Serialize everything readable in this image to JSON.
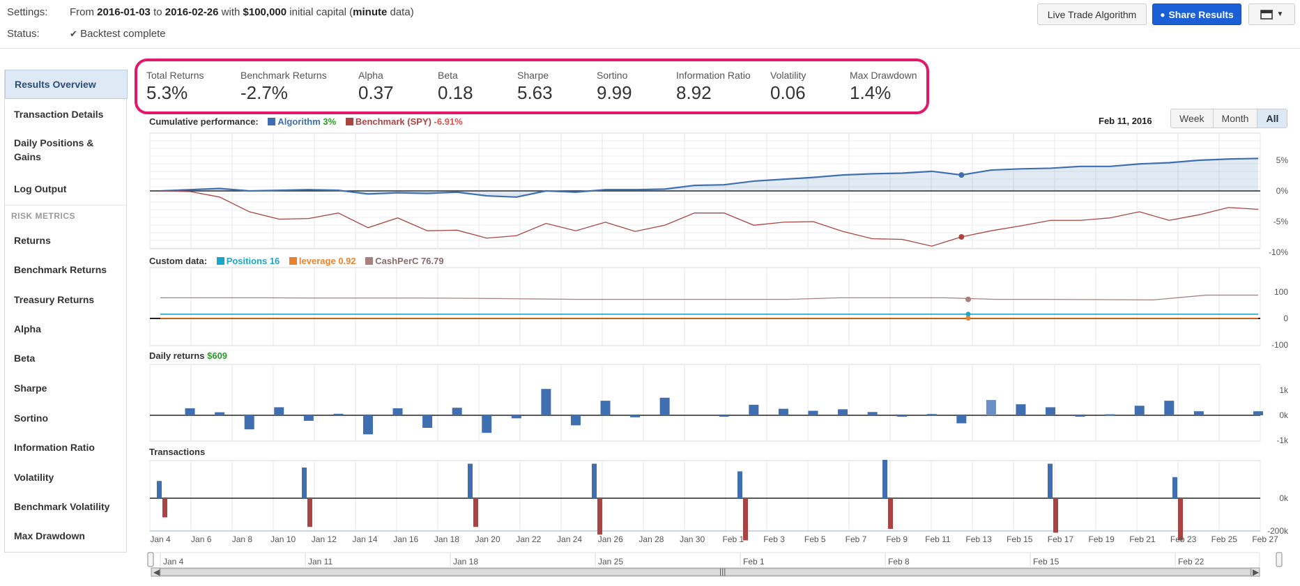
{
  "settings": {
    "label": "Settings:",
    "from_word": "From",
    "start": "2016-01-03",
    "to_word": "to",
    "end": "2016-02-26",
    "with_word": "with",
    "capital": "$100,000",
    "capital_suffix": "initial capital (",
    "frequency": "minute",
    "freq_suffix": "data)"
  },
  "status": {
    "label": "Status:",
    "value": "Backtest complete",
    "icon": "check-icon"
  },
  "toolbar": {
    "live_trade": "Live Trade Algorithm",
    "share": "Share Results",
    "share_icon": "comments-icon",
    "menu_icon": "calendar-icon"
  },
  "sidebar": {
    "items": [
      "Results Overview",
      "Transaction Details",
      "Daily Positions & Gains",
      "Log Output"
    ],
    "risk_header": "RISK METRICS",
    "risk_items": [
      "Returns",
      "Benchmark Returns",
      "Treasury Returns",
      "Alpha",
      "Beta",
      "Sharpe",
      "Sortino",
      "Information Ratio",
      "Volatility",
      "Benchmark Volatility",
      "Max Drawdown"
    ]
  },
  "metrics": [
    {
      "label": "Total Returns",
      "value": "5.3%"
    },
    {
      "label": "Benchmark Returns",
      "value": "-2.7%"
    },
    {
      "label": "Alpha",
      "value": "0.37"
    },
    {
      "label": "Beta",
      "value": "0.18"
    },
    {
      "label": "Sharpe",
      "value": "5.63"
    },
    {
      "label": "Sortino",
      "value": "9.99"
    },
    {
      "label": "Information Ratio",
      "value": "8.92"
    },
    {
      "label": "Volatility",
      "value": "0.06"
    },
    {
      "label": "Max Drawdown",
      "value": "1.4%"
    }
  ],
  "cumulative": {
    "label": "Cumulative performance:",
    "algo_name": "Algorithm",
    "algo_value": "3%",
    "bench_name": "Benchmark (SPY)",
    "bench_value": "-6.91%",
    "hover_date": "Feb 11, 2016",
    "range_buttons": [
      "Week",
      "Month",
      "All"
    ],
    "active_range": "All"
  },
  "custom": {
    "label": "Custom data:",
    "series": [
      {
        "name": "Positions",
        "value": "16",
        "color": "#1aa6c8"
      },
      {
        "name": "leverage",
        "value": "0.92",
        "color": "#e8822e"
      },
      {
        "name": "CashPerC",
        "value": "76.79",
        "color": "#a98080"
      }
    ]
  },
  "daily": {
    "label": "Daily returns",
    "value": "$609"
  },
  "transactions": {
    "label": "Transactions"
  },
  "colors": {
    "algo": "#3f6fb0",
    "bench": "#a94442",
    "accent": "#e3186a",
    "primary": "#1a5fd6"
  },
  "chart_data": [
    {
      "type": "line",
      "title": "Cumulative performance",
      "x": [
        "Jan 4",
        "Jan 5",
        "Jan 6",
        "Jan 7",
        "Jan 8",
        "Jan 11",
        "Jan 12",
        "Jan 13",
        "Jan 14",
        "Jan 15",
        "Jan 19",
        "Jan 20",
        "Jan 21",
        "Jan 22",
        "Jan 25",
        "Jan 26",
        "Jan 27",
        "Jan 28",
        "Jan 29",
        "Feb 1",
        "Feb 2",
        "Feb 3",
        "Feb 4",
        "Feb 5",
        "Feb 8",
        "Feb 9",
        "Feb 10",
        "Feb 11",
        "Feb 12",
        "Feb 16",
        "Feb 17",
        "Feb 18",
        "Feb 19",
        "Feb 22",
        "Feb 23",
        "Feb 24",
        "Feb 25",
        "Feb 26"
      ],
      "series": [
        {
          "name": "Algorithm",
          "values": [
            0,
            0.2,
            0.4,
            0.0,
            0.1,
            0.2,
            0.1,
            -0.5,
            -0.3,
            -0.4,
            -0.2,
            -0.8,
            -1.0,
            0.0,
            -0.2,
            0.2,
            0.2,
            0.3,
            0.9,
            1.0,
            1.6,
            1.9,
            2.2,
            2.6,
            2.8,
            2.9,
            3.2,
            2.6,
            3.4,
            3.6,
            3.7,
            4.0,
            4.0,
            4.4,
            4.6,
            5.0,
            5.2,
            5.3
          ]
        },
        {
          "name": "Benchmark (SPY)",
          "values": [
            0,
            -0.1,
            -1.0,
            -3.4,
            -4.6,
            -4.5,
            -3.6,
            -6.0,
            -4.4,
            -6.5,
            -6.4,
            -7.7,
            -7.3,
            -5.3,
            -6.5,
            -5.1,
            -6.6,
            -5.6,
            -3.6,
            -3.6,
            -5.6,
            -5.1,
            -5.0,
            -6.6,
            -7.8,
            -7.9,
            -9.0,
            -7.5,
            -6.5,
            -5.7,
            -4.8,
            -4.8,
            -4.4,
            -3.4,
            -4.8,
            -3.9,
            -2.7,
            -3.0
          ]
        }
      ],
      "yticks": [
        "5%",
        "0%",
        "-5%",
        "-10%"
      ],
      "ylim": [
        -10,
        5
      ]
    },
    {
      "type": "line",
      "title": "Custom data",
      "series": [
        {
          "name": "Positions",
          "values": [
            16,
            16,
            16,
            16,
            16,
            16,
            16,
            16,
            16,
            16,
            16,
            16,
            16,
            16,
            16,
            16,
            16,
            16,
            16,
            16,
            16,
            16
          ]
        },
        {
          "name": "leverage",
          "values": [
            0.92,
            0.92,
            0.92,
            0.92,
            0.92,
            0.92,
            0.92,
            0.92,
            0.92,
            0.92,
            0.92,
            0.92,
            0.92,
            0.92,
            0.92,
            0.92,
            0.92,
            0.92,
            0.92,
            0.92,
            0.92,
            0.92
          ]
        },
        {
          "name": "CashPerC",
          "values": [
            78,
            78,
            78,
            77,
            77,
            77,
            76,
            74,
            72,
            72,
            72,
            72,
            72,
            78,
            78,
            78,
            72,
            72,
            71,
            70,
            88,
            88
          ]
        }
      ],
      "yticks": [
        "100",
        "0",
        "-100"
      ],
      "ylim": [
        -100,
        120
      ]
    },
    {
      "type": "bar",
      "title": "Daily returns",
      "x": [
        "Jan 4",
        "Jan 5",
        "Jan 6",
        "Jan 7",
        "Jan 8",
        "Jan 11",
        "Jan 12",
        "Jan 13",
        "Jan 14",
        "Jan 15",
        "Jan 19",
        "Jan 20",
        "Jan 21",
        "Jan 22",
        "Jan 25",
        "Jan 26",
        "Jan 27",
        "Jan 28",
        "Jan 29",
        "Feb 1",
        "Feb 2",
        "Feb 3",
        "Feb 4",
        "Feb 5",
        "Feb 8",
        "Feb 9",
        "Feb 10",
        "Feb 11",
        "Feb 12",
        "Feb 16",
        "Feb 17",
        "Feb 18",
        "Feb 19",
        "Feb 22",
        "Feb 23",
        "Feb 24",
        "Feb 25",
        "Feb 26"
      ],
      "values": [
        0,
        280,
        120,
        -560,
        320,
        -220,
        60,
        -760,
        280,
        -500,
        300,
        -700,
        -120,
        1050,
        -400,
        580,
        -80,
        700,
        0,
        -40,
        420,
        260,
        180,
        240,
        130,
        -40,
        50,
        -320,
        609,
        440,
        320,
        -40,
        40,
        380,
        580,
        160,
        0,
        160
      ],
      "yticks": [
        "1k",
        "0k",
        "-1k"
      ],
      "ylim": [
        -1000,
        1000
      ]
    },
    {
      "type": "bar",
      "title": "Transactions",
      "x": [
        "Jan 4",
        "Jan 11",
        "Jan 19",
        "Jan 25",
        "Feb 1",
        "Feb 8",
        "Feb 16",
        "Feb 22"
      ],
      "series": [
        {
          "name": "buys",
          "values": [
            45000,
            80000,
            90000,
            90000,
            70000,
            100000,
            90000,
            55000
          ]
        },
        {
          "name": "sells",
          "values": [
            -50000,
            -75000,
            -75000,
            -95000,
            -110000,
            -80000,
            -90000,
            -110000
          ]
        }
      ],
      "yticks": [
        "0k",
        "-200k"
      ],
      "ylim": [
        -200000,
        200000
      ]
    }
  ],
  "xaxis": {
    "ticks": [
      "Jan 4",
      "Jan 6",
      "Jan 8",
      "Jan 10",
      "Jan 12",
      "Jan 14",
      "Jan 16",
      "Jan 18",
      "Jan 20",
      "Jan 22",
      "Jan 24",
      "Jan 26",
      "Jan 28",
      "Jan 30",
      "Feb 1",
      "Feb 3",
      "Feb 5",
      "Feb 7",
      "Feb 9",
      "Feb 11",
      "Feb 13",
      "Feb 15",
      "Feb 17",
      "Feb 19",
      "Feb 21",
      "Feb 23",
      "Feb 25",
      "Feb 27"
    ]
  },
  "navigator": {
    "ticks": [
      "Jan 4",
      "Jan 11",
      "Jan 18",
      "Jan 25",
      "Feb 1",
      "Feb 8",
      "Feb 15",
      "Feb 22"
    ]
  }
}
